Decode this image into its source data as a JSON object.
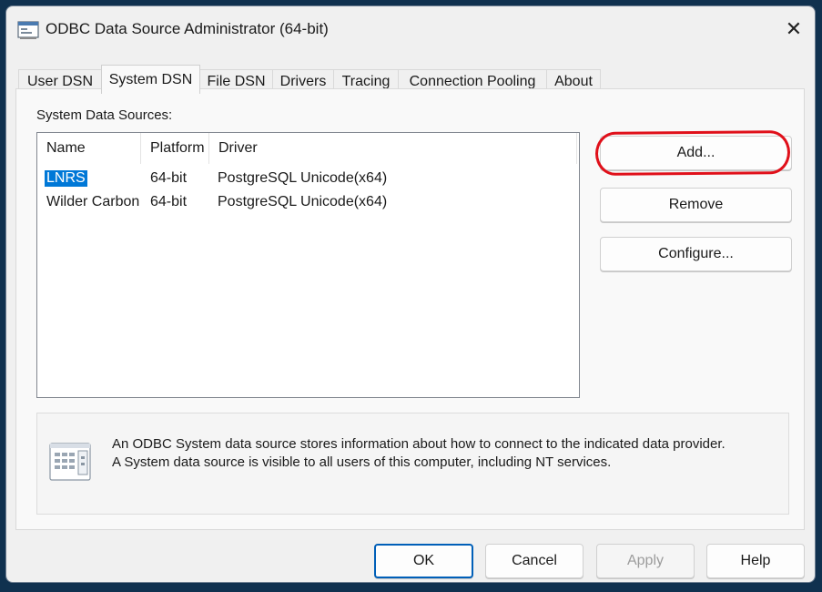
{
  "window": {
    "title": "ODBC Data Source Administrator (64-bit)",
    "close_glyph": "✕"
  },
  "tabs": [
    {
      "label": "User DSN"
    },
    {
      "label": "System DSN",
      "active": true
    },
    {
      "label": "File DSN"
    },
    {
      "label": "Drivers"
    },
    {
      "label": "Tracing"
    },
    {
      "label": "Connection Pooling"
    },
    {
      "label": "About"
    }
  ],
  "system_dsn": {
    "section_label": "System Data Sources:",
    "columns": [
      "Name",
      "Platform",
      "Driver"
    ],
    "rows": [
      {
        "name": "LNRS",
        "platform": "64-bit",
        "driver": "PostgreSQL Unicode(x64)",
        "selected": true
      },
      {
        "name": "Wilder Carbon",
        "platform": "64-bit",
        "driver": "PostgreSQL Unicode(x64)",
        "selected": false
      }
    ],
    "buttons": {
      "add": "Add...",
      "remove": "Remove",
      "configure": "Configure..."
    },
    "info_line1": "An ODBC System data source stores information about how to connect to the indicated data provider.",
    "info_line2": "A System data source is visible to all users of this computer, including NT services."
  },
  "footer": {
    "ok": "OK",
    "cancel": "Cancel",
    "apply": "Apply",
    "help": "Help"
  },
  "colors": {
    "selection": "#0078d7",
    "annotation": "#e0101a",
    "default_button_border": "#005fb8"
  },
  "icons": [
    "app-window-icon",
    "close-icon",
    "info-document-icon"
  ]
}
